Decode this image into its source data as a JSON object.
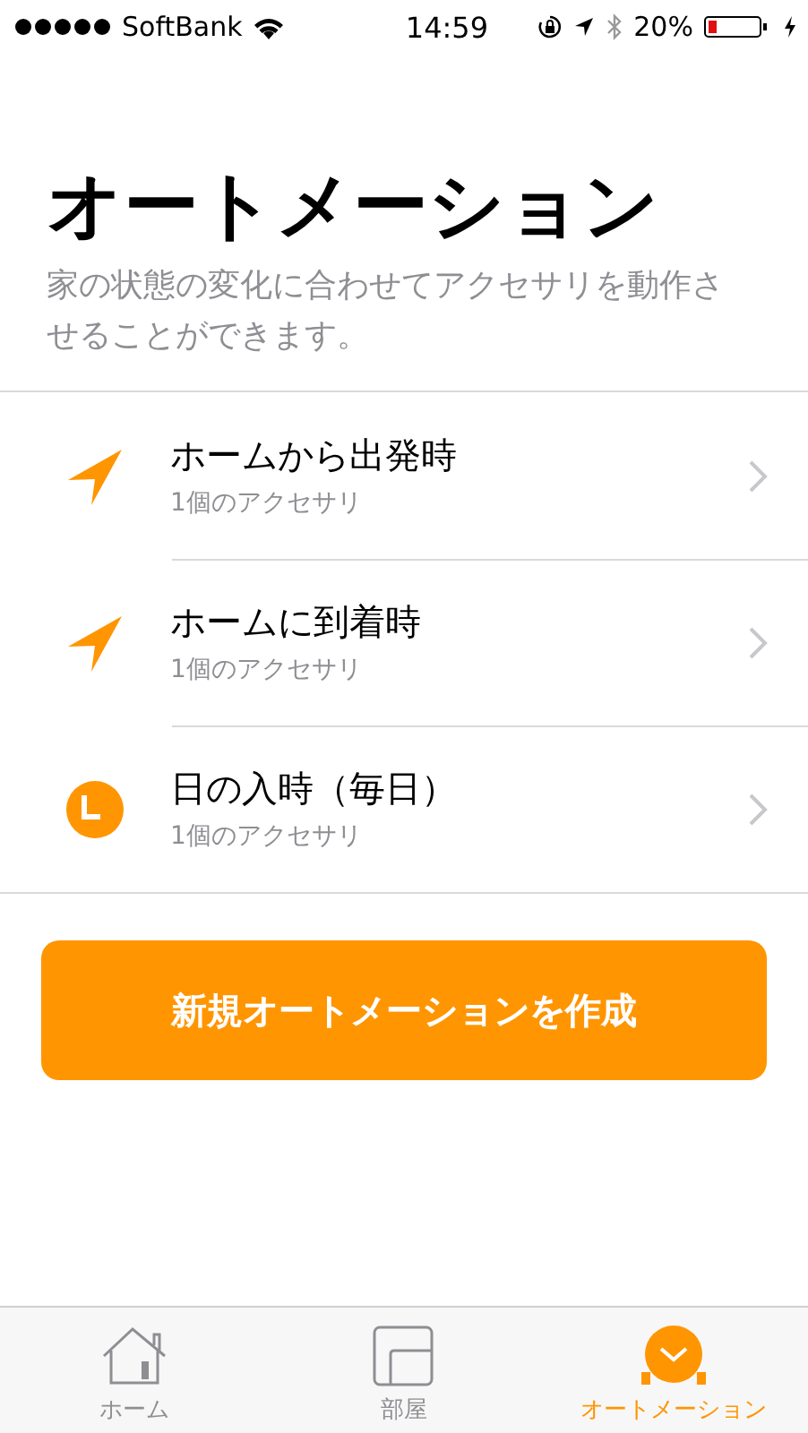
{
  "status_bar": {
    "carrier": "SoftBank",
    "time": "14:59",
    "battery": "20%"
  },
  "title": "オートメーション",
  "subtitle": "家の状態の変化に合わせてアクセサリを動作させることができます。",
  "automations": [
    {
      "kind": "location",
      "title": "ホームから出発時",
      "detail": "1個のアクセサリ"
    },
    {
      "kind": "location",
      "title": "ホームに到着時",
      "detail": "1個のアクセサリ"
    },
    {
      "kind": "clock",
      "title": "日の入時（毎日）",
      "detail": "1個のアクセサリ"
    }
  ],
  "create_button": "新規オートメーションを作成",
  "tabs": [
    {
      "kind": "home",
      "label": "ホーム",
      "selected": false
    },
    {
      "kind": "rooms",
      "label": "部屋",
      "selected": false
    },
    {
      "kind": "automation",
      "label": "オートメーション",
      "selected": true
    }
  ]
}
